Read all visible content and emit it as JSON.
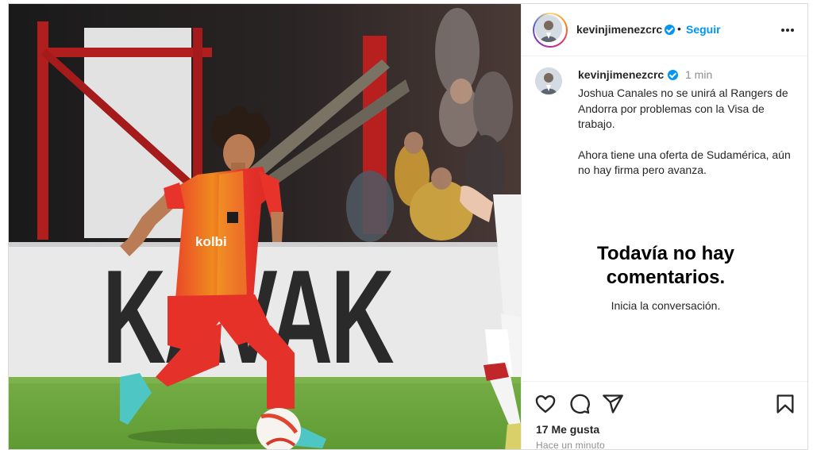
{
  "post": {
    "photo": {
      "description_icon": "soccer-photo",
      "ad_board_text": "KAVAK",
      "shirt_sponsor": "kolbi"
    },
    "header": {
      "username": "kevinjimenezcrc",
      "dot": "•",
      "follow_label": "Seguir",
      "more_icon": "more-horizontal-icon"
    },
    "caption": {
      "username": "kevinjimenezcrc",
      "time": "1 min",
      "paragraph_1": "Joshua Canales no se unirá al Rangers de Andorra por problemas con la Visa de trabajo.",
      "paragraph_2": "Ahora tiene una oferta de Sudamérica, aún no hay firma pero avanza."
    },
    "comments": {
      "empty_title": "Todavía no hay comentarios.",
      "empty_subtitle": "Inicia la conversación."
    },
    "actions": {
      "icons": [
        "heart-icon",
        "comment-icon",
        "share-icon",
        "bookmark-icon"
      ],
      "likes": "17 Me gusta",
      "time_ago": "Hace un minuto"
    },
    "colors": {
      "accent": "#0095f6",
      "kit_red": "#e8332b",
      "kit_yellow": "#f0a21c",
      "pitch": "#6aa63b"
    }
  }
}
